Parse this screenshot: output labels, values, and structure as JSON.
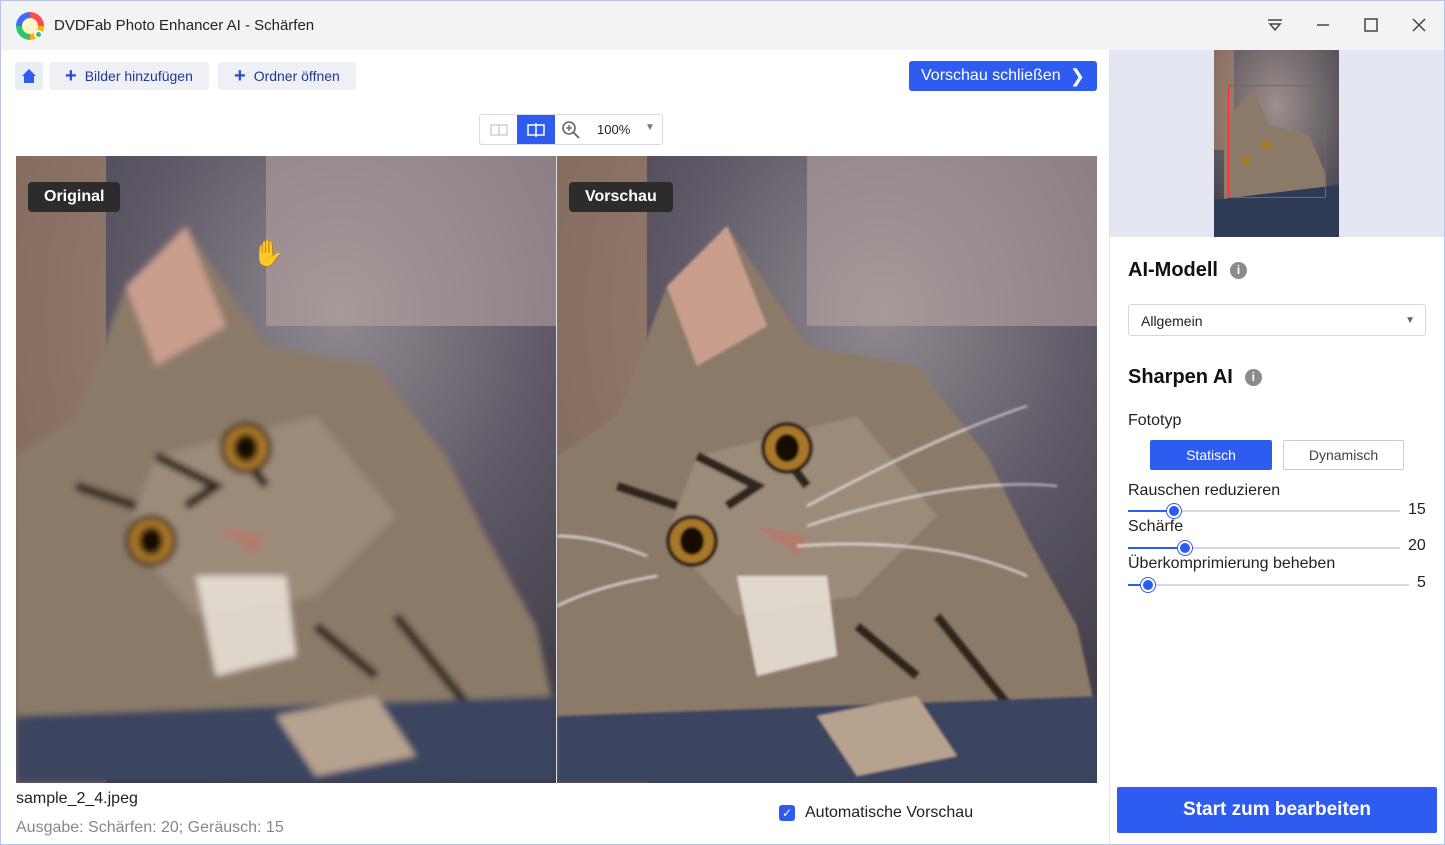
{
  "window": {
    "title": "DVDFab Photo Enhancer AI - Schärfen",
    "controls": [
      "dropdown-icon",
      "minimize-icon",
      "maximize-icon",
      "close-icon"
    ]
  },
  "toolbar": {
    "add_images": "Bilder hinzufügen",
    "open_folder": "Ordner öffnen",
    "close_preview": "Vorschau schließen"
  },
  "view": {
    "zoom": "100%",
    "mode": "split"
  },
  "panes": {
    "left_label": "Original",
    "right_label": "Vorschau"
  },
  "footer": {
    "file_name": "sample_2_4.jpeg",
    "output": "Ausgabe: Schärfen: 20; Geräusch: 15",
    "auto_preview": "Automatische Vorschau",
    "auto_preview_checked": true
  },
  "panel": {
    "ai_model_title": "AI-Modell",
    "ai_model_value": "Allgemein",
    "sharpen_title": "Sharpen AI",
    "photo_type_label": "Fototyp",
    "photo_type_options": [
      "Statisch",
      "Dynamisch"
    ],
    "photo_type_selected": "Statisch",
    "sliders": [
      {
        "label": "Rauschen reduzieren",
        "value": "15",
        "fraction": 0.17
      },
      {
        "label": "Schärfe",
        "value": "20",
        "fraction": 0.21
      },
      {
        "label": "Überkomprimierung beheben",
        "value": "5",
        "fraction": 0.07
      }
    ],
    "start_button": "Start zum bearbeiten"
  },
  "colors": {
    "accent": "#2f5cf0",
    "titlebar": "#f3f3f6"
  }
}
